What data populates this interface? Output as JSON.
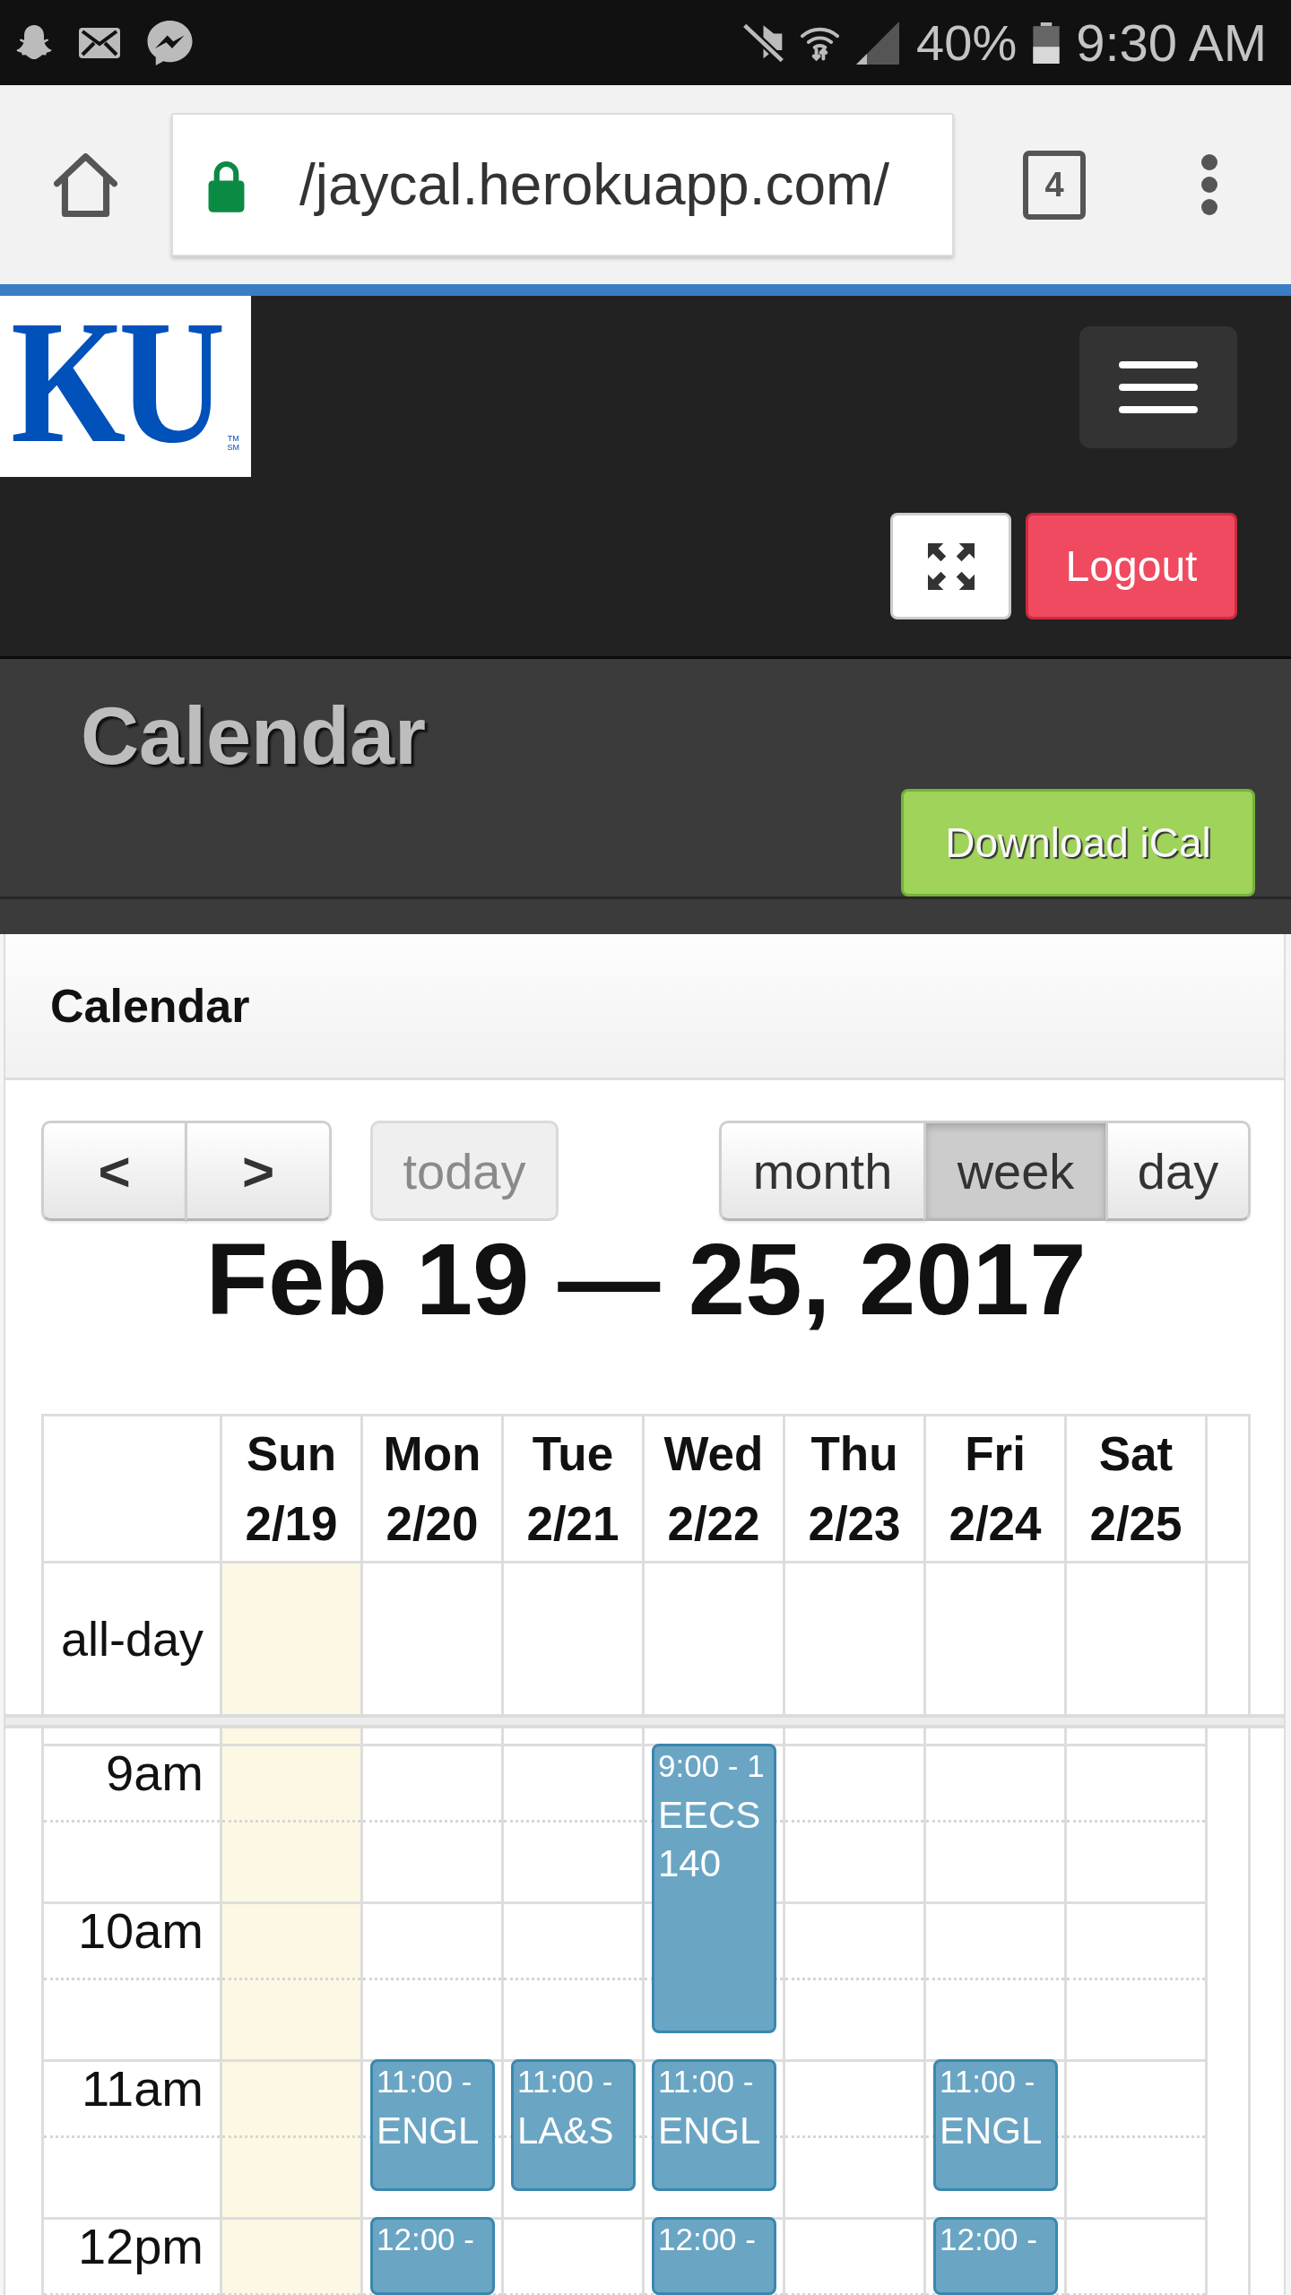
{
  "status_bar": {
    "battery": "40%",
    "time": "9:30 AM"
  },
  "browser": {
    "url": "/jaycal.herokuapp.com/",
    "tab_count": "4"
  },
  "navbar": {
    "logo": {
      "text": "KU",
      "marks": [
        "TM",
        "SM"
      ]
    },
    "logout": "Logout"
  },
  "page_header": {
    "title": "Calendar",
    "download": "Download iCal"
  },
  "panel": {
    "heading": "Calendar"
  },
  "toolbar": {
    "nav": [
      "<",
      ">"
    ],
    "today": {
      "label": "today",
      "disabled": true
    },
    "views": [
      {
        "label": "month",
        "selected": false
      },
      {
        "label": "week",
        "selected": true
      },
      {
        "label": "day",
        "selected": false
      }
    ]
  },
  "range_title": "Feb 19 — 25, 2017",
  "week": {
    "all_day_label": "all-day",
    "hours": [
      "9am",
      "10am",
      "11am",
      "12pm"
    ],
    "days": [
      {
        "name": "Sun",
        "date": "2/19",
        "today": true
      },
      {
        "name": "Mon",
        "date": "2/20",
        "today": false,
        "events": [
          {
            "kind": "short",
            "time": "11:00 -",
            "title": "ENGL"
          },
          {
            "kind": "open",
            "time": "12:00 -"
          }
        ]
      },
      {
        "name": "Tue",
        "date": "2/21",
        "today": false,
        "events": [
          {
            "kind": "short",
            "time": "11:00 -",
            "title": "LA&S"
          }
        ]
      },
      {
        "name": "Wed",
        "date": "2/22",
        "today": false,
        "events": [
          {
            "kind": "long",
            "time": "9:00 - 1",
            "title": "EECS 140"
          },
          {
            "kind": "short",
            "time": "11:00 -",
            "title": "ENGL"
          },
          {
            "kind": "open",
            "time": "12:00 -"
          }
        ]
      },
      {
        "name": "Thu",
        "date": "2/23",
        "today": false
      },
      {
        "name": "Fri",
        "date": "2/24",
        "today": false,
        "events": [
          {
            "kind": "short",
            "time": "11:00 -",
            "title": "ENGL"
          },
          {
            "kind": "open",
            "time": "12:00 -"
          }
        ]
      },
      {
        "name": "Sat",
        "date": "2/25",
        "today": false
      }
    ]
  }
}
